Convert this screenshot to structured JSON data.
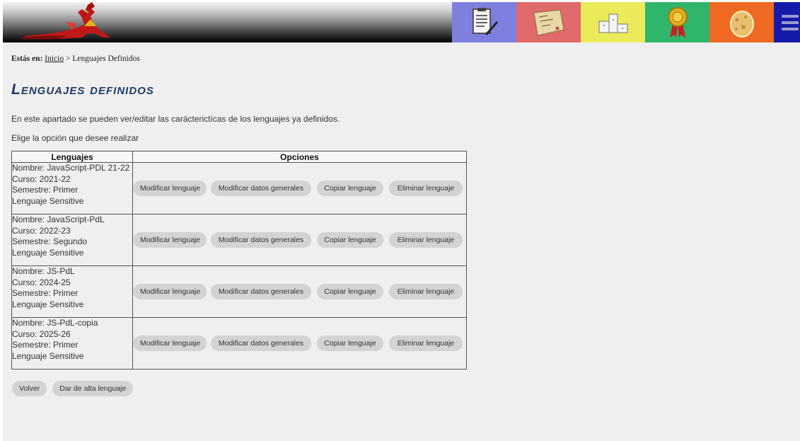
{
  "header": {
    "logo_icon": "red-dragon-logo",
    "tabs": [
      {
        "icon": "notepad-pencil-icon",
        "color": "#7f7fe0"
      },
      {
        "icon": "treasure-map-icon",
        "color": "#e06a6a"
      },
      {
        "icon": "podium-icon",
        "color": "#eaea5a"
      },
      {
        "icon": "medal-icon",
        "color": "#2fb56c"
      },
      {
        "icon": "dragon-egg-icon",
        "color": "#ee6a22"
      },
      {
        "icon": "hamburger-menu-icon",
        "color": "#161aa8"
      }
    ]
  },
  "breadcrumb": {
    "prefix": "Estás en:",
    "home": "Inicio",
    "separator": " > ",
    "current": "Lenguajes Definidos"
  },
  "page": {
    "title": "Lenguajes definidos",
    "intro": "En este apartado se pueden ver/editar las carácterictícas de los lenguajes ya definidos.",
    "instruction": "Elige la opción que desee realizar"
  },
  "table": {
    "headers": {
      "languages": "Lenguajes",
      "options": "Opciones"
    },
    "rows": [
      {
        "name": "Nombre: JavaScript-PDL 21-22",
        "course": "Curso: 2021-22",
        "semester": "Semestre: Primer",
        "sensitivity": "Lenguaje Sensitive"
      },
      {
        "name": "Nombre: JavaScript-PdL",
        "course": "Curso: 2022-23",
        "semester": "Semestre: Segundo",
        "sensitivity": "Lenguaje Sensitive"
      },
      {
        "name": "Nombre: JS-PdL",
        "course": "Curso: 2024-25",
        "semester": "Semestre: Primer",
        "sensitivity": "Lenguaje Sensitive"
      },
      {
        "name": "Nombre: JS-PdL-copia",
        "course": "Curso: 2025-26",
        "semester": "Semestre: Primer",
        "sensitivity": "Lenguaje Sensitive"
      }
    ],
    "row_buttons": {
      "modify": "Modificar lenguaje",
      "modify_general": "Modificar datos generales",
      "copy": "Copiar lenguaje",
      "delete": "Eliminar lenguaje"
    }
  },
  "footer_buttons": {
    "back": "Volver",
    "add": "Dar de alta lenguaje"
  }
}
